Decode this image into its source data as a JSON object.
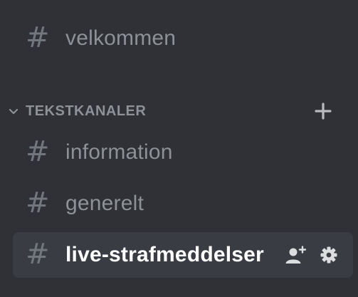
{
  "channels_top": [
    {
      "name": "velkommen"
    }
  ],
  "category": {
    "label": "TEKSTKANALER"
  },
  "channels": [
    {
      "name": "information"
    },
    {
      "name": "generelt"
    },
    {
      "name": "live-strafmeddelser",
      "selected": true
    }
  ],
  "icons": {
    "hash": "#",
    "chevron": "chevron-down-icon",
    "add": "plus-icon",
    "invite": "invite-member-icon",
    "settings": "gear-icon"
  },
  "colors": {
    "background": "#2f3136",
    "selected_bg": "#393c43",
    "text_muted": "#8e9297",
    "hash": "#72767d",
    "text_selected": "#ffffff"
  }
}
